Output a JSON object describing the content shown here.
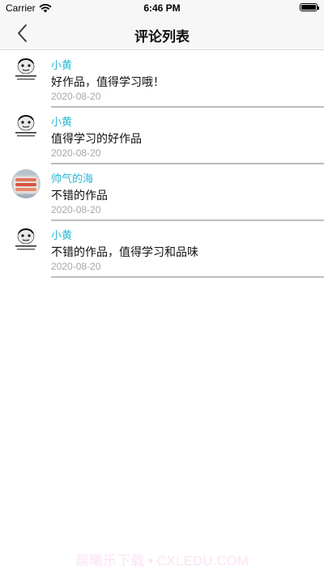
{
  "status_bar": {
    "carrier": "Carrier",
    "time": "6:46 PM",
    "wifi_icon": "wifi-icon",
    "battery_icon": "battery-icon",
    "battery_level": 1.0
  },
  "nav": {
    "title": "评论列表",
    "back_icon": "chevron-left-icon"
  },
  "comments": [
    {
      "name": "小黄",
      "text": "好作品，值得学习哦！",
      "date": "2020-08-20",
      "avatar": "meme-face"
    },
    {
      "name": "小黄",
      "text": "值得学习的好作品",
      "date": "2020-08-20",
      "avatar": "meme-face"
    },
    {
      "name": "帅气的海",
      "text": "不错的作品",
      "date": "2020-08-20",
      "avatar": "food-photo"
    },
    {
      "name": "小黄",
      "text": "不错的作品，值得学习和品味",
      "date": "2020-08-20",
      "avatar": "meme-face"
    }
  ],
  "colors": {
    "username": "#2bb7d4",
    "date": "#a6a6a6",
    "divider": "#bdbdbd",
    "watermark": "#fbe3f4"
  },
  "watermark": "晨曦乐下载 • CXLEDU.COM"
}
